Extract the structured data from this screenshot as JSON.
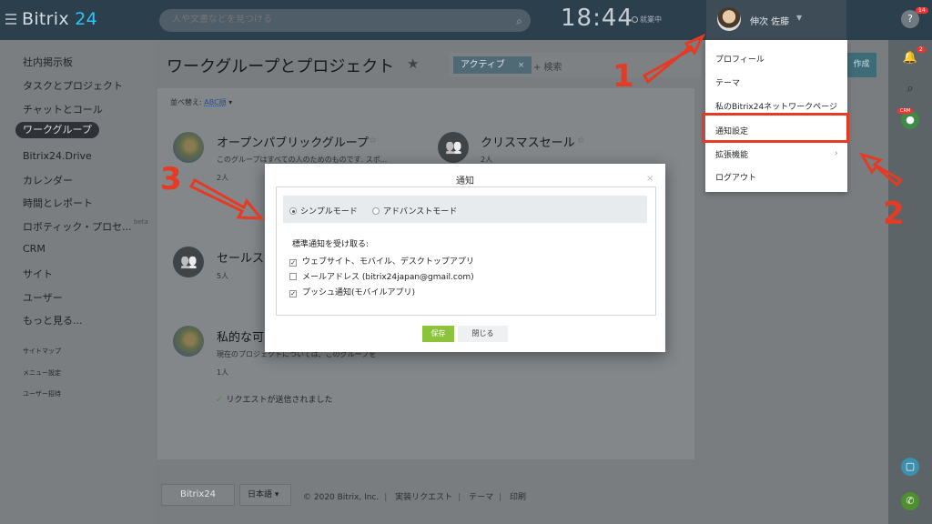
{
  "app": {
    "logo_text": "Bitrix",
    "logo_num": "24"
  },
  "search": {
    "placeholder": "人や文書などを見つける"
  },
  "header": {
    "time": "18:44",
    "work_status": "就業中",
    "user_name": "伸次 佐藤"
  },
  "sidebar": {
    "items": [
      {
        "label": "社内掲示板"
      },
      {
        "label": "タスクとプロジェクト"
      },
      {
        "label": "チャットとコール"
      },
      {
        "label": "ワークグループ"
      },
      {
        "label": "Bitrix24.Drive"
      },
      {
        "label": "カレンダー"
      },
      {
        "label": "時間とレポート"
      },
      {
        "label": "ロボティック・プロセ..."
      },
      {
        "label": "CRM"
      },
      {
        "label": "サイト"
      },
      {
        "label": "ユーザー"
      },
      {
        "label": "もっと見る..."
      }
    ],
    "beta": "beta",
    "small": [
      {
        "label": "サイトマップ"
      },
      {
        "label": "メニュー設定"
      },
      {
        "label": "ユーザー招待"
      }
    ]
  },
  "main": {
    "title": "ワークグループとプロジェクト",
    "filter_chip": "アクティブ",
    "filter_search": "+ 検索",
    "create_btn": "作成",
    "sort_label": "並べ替え:",
    "sort_value": "ABC順",
    "groups": [
      {
        "name": "オープンパブリックグループ",
        "desc": "このグループはすべての人のためのものです. スポ...",
        "count": "2人"
      },
      {
        "name": "クリスマスセール",
        "desc": "",
        "count": "2人"
      },
      {
        "name": "セールスチ",
        "desc": "",
        "count": "5人"
      },
      {
        "name": "私的な可",
        "desc": "現在のプロジェクトについては、このグループを",
        "count": "1人"
      }
    ],
    "request_sent": "リクエストが送信されました"
  },
  "footer": {
    "logo": "Bitrix24",
    "language": "日本語",
    "copyright": "© 2020 Bitrix, Inc.",
    "links": [
      "実装リクエスト",
      "テーマ",
      "印刷"
    ]
  },
  "user_menu": {
    "items": [
      {
        "label": "プロフィール"
      },
      {
        "label": "テーマ"
      },
      {
        "label": "私のBitrix24ネットワークページ"
      },
      {
        "label": "通知設定"
      },
      {
        "label": "拡張機能"
      },
      {
        "label": "ログアウト"
      }
    ]
  },
  "modal": {
    "title": "通知",
    "simple_mode": "シンプルモード",
    "advanced_mode": "アドバンストモード",
    "receive_label": "標準通知を受け取る:",
    "options": [
      {
        "label": "ウェブサイト、モバイル、デスクトップアプリ",
        "checked": true
      },
      {
        "label": "メールアドレス (bitrix24japan@gmail.com)",
        "checked": false
      },
      {
        "label": "プッシュ通知(モバイルアプリ)",
        "checked": true
      }
    ],
    "save": "保存",
    "close": "閉じる"
  },
  "right_panel": {
    "help_badge": "14",
    "bell_badge": "2",
    "crm_badge": "CRM"
  },
  "annotations": {
    "step1": "1",
    "step2": "2",
    "step3": "3",
    "color": "#e53a23"
  },
  "colors": {
    "accent": "#2fc6f6",
    "save_button": "#8bc33b",
    "topbar": "#2b3f4d"
  }
}
